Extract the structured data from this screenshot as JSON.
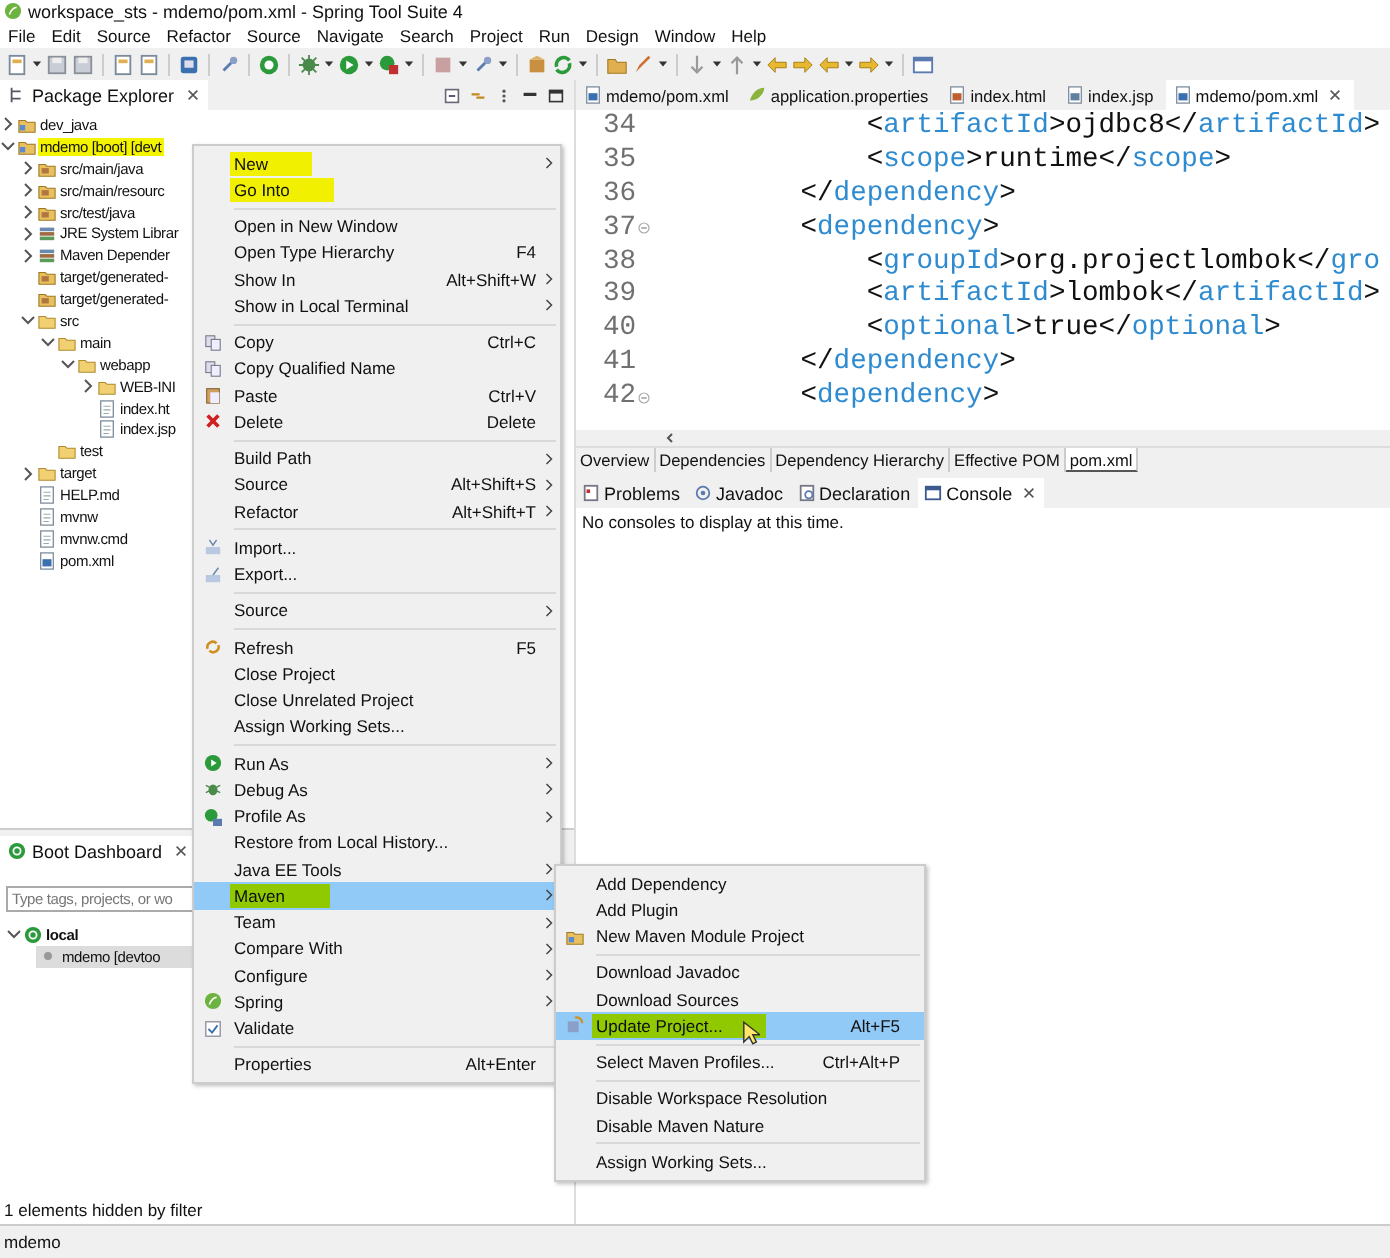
{
  "window": {
    "title": "workspace_sts - mdemo/pom.xml - Spring Tool Suite 4"
  },
  "menu_bar": [
    "File",
    "Edit",
    "Source",
    "Refactor",
    "Source",
    "Navigate",
    "Search",
    "Project",
    "Run",
    "Design",
    "Window",
    "Help"
  ],
  "package_explorer": {
    "title": "Package Explorer",
    "tree": [
      {
        "label": "dev_java",
        "kind": "project",
        "expanded": false,
        "marked": false
      },
      {
        "label": "mdemo [boot] [devt",
        "kind": "project",
        "expanded": true,
        "marked": true,
        "children": [
          {
            "label": "src/main/java",
            "kind": "source-folder",
            "expanded": false,
            "marked": false
          },
          {
            "label": "src/main/resourc",
            "kind": "source-folder",
            "expanded": false,
            "marked": false
          },
          {
            "label": "src/test/java",
            "kind": "source-folder",
            "expanded": false,
            "marked": false
          },
          {
            "label": "JRE System Librar",
            "kind": "library",
            "expanded": false,
            "marked": false
          },
          {
            "label": "Maven Depender",
            "kind": "library",
            "expanded": false,
            "marked": false
          },
          {
            "label": "target/generated-",
            "kind": "source-folder",
            "marked": false
          },
          {
            "label": "target/generated-",
            "kind": "source-folder",
            "marked": false
          },
          {
            "label": "src",
            "kind": "folder",
            "expanded": true,
            "marked": false,
            "children": [
              {
                "label": "main",
                "kind": "folder",
                "expanded": true,
                "marked": false,
                "children": [
                  {
                    "label": "webapp",
                    "kind": "folder",
                    "expanded": true,
                    "marked": false,
                    "children": [
                      {
                        "label": "WEB-INI",
                        "kind": "folder",
                        "expanded": false,
                        "marked": false
                      },
                      {
                        "label": "index.ht",
                        "kind": "file",
                        "marked": false
                      },
                      {
                        "label": "index.jsp",
                        "kind": "file",
                        "marked": false
                      }
                    ]
                  }
                ]
              },
              {
                "label": "test",
                "kind": "folder",
                "marked": false
              }
            ]
          },
          {
            "label": "target",
            "kind": "folder",
            "expanded": false,
            "marked": false
          },
          {
            "label": "HELP.md",
            "kind": "file",
            "marked": false
          },
          {
            "label": "mvnw",
            "kind": "file",
            "marked": false
          },
          {
            "label": "mvnw.cmd",
            "kind": "file",
            "marked": false
          },
          {
            "label": "pom.xml",
            "kind": "xml",
            "marked": false
          }
        ]
      }
    ]
  },
  "boot_dashboard": {
    "title": "Boot Dashboard",
    "search": {
      "placeholder": "Type tags, projects, or wo"
    },
    "tree": [
      {
        "label": "local",
        "expanded": true,
        "selected": false,
        "children": [
          {
            "label": "mdemo [devtoo",
            "selected": true
          }
        ]
      }
    ],
    "footer": "1 elements hidden by filter"
  },
  "editor": {
    "tabs": [
      {
        "label": "mdemo/pom.xml",
        "kind": "xml",
        "selected": false
      },
      {
        "label": "application.properties",
        "kind": "properties",
        "selected": false
      },
      {
        "label": "index.html",
        "kind": "html",
        "selected": false
      },
      {
        "label": "index.jsp",
        "kind": "jsp",
        "selected": false
      },
      {
        "label": "mdemo/pom.xml",
        "kind": "xml",
        "selected": true
      }
    ],
    "lines": [
      {
        "number": "34",
        "fold": false,
        "tokens": [
          {
            "kind": "plain",
            "text": "            <"
          },
          {
            "kind": "tag",
            "text": "artifactId"
          },
          {
            "kind": "plain",
            "text": ">ojdbc8</"
          },
          {
            "kind": "tag",
            "text": "artifactId"
          },
          {
            "kind": "plain",
            "text": ">"
          }
        ]
      },
      {
        "number": "35",
        "fold": false,
        "tokens": [
          {
            "kind": "plain",
            "text": "            <"
          },
          {
            "kind": "tag",
            "text": "scope"
          },
          {
            "kind": "plain",
            "text": ">runtime</"
          },
          {
            "kind": "tag",
            "text": "scope"
          },
          {
            "kind": "plain",
            "text": ">"
          }
        ]
      },
      {
        "number": "36",
        "fold": false,
        "tokens": [
          {
            "kind": "plain",
            "text": "        </"
          },
          {
            "kind": "tag",
            "text": "dependency"
          },
          {
            "kind": "plain",
            "text": ">"
          }
        ]
      },
      {
        "number": "37",
        "fold": true,
        "tokens": [
          {
            "kind": "plain",
            "text": "        <"
          },
          {
            "kind": "tag",
            "text": "dependency"
          },
          {
            "kind": "plain",
            "text": ">"
          }
        ]
      },
      {
        "number": "38",
        "fold": false,
        "tokens": [
          {
            "kind": "plain",
            "text": "            <"
          },
          {
            "kind": "tag",
            "text": "groupId"
          },
          {
            "kind": "plain",
            "text": ">org.projectlombok</"
          },
          {
            "kind": "tag",
            "text": "gro"
          }
        ]
      },
      {
        "number": "39",
        "fold": false,
        "tokens": [
          {
            "kind": "plain",
            "text": "            <"
          },
          {
            "kind": "tag",
            "text": "artifactId"
          },
          {
            "kind": "plain",
            "text": ">lombok</"
          },
          {
            "kind": "tag",
            "text": "artifactId"
          },
          {
            "kind": "plain",
            "text": ">"
          }
        ]
      },
      {
        "number": "40",
        "fold": false,
        "tokens": [
          {
            "kind": "plain",
            "text": "            <"
          },
          {
            "kind": "tag",
            "text": "optional"
          },
          {
            "kind": "plain",
            "text": ">true</"
          },
          {
            "kind": "tag",
            "text": "optional"
          },
          {
            "kind": "plain",
            "text": ">"
          }
        ]
      },
      {
        "number": "41",
        "fold": false,
        "tokens": [
          {
            "kind": "plain",
            "text": "        </"
          },
          {
            "kind": "tag",
            "text": "dependency"
          },
          {
            "kind": "plain",
            "text": ">"
          }
        ]
      },
      {
        "number": "42",
        "fold": true,
        "tokens": [
          {
            "kind": "plain",
            "text": "        <"
          },
          {
            "kind": "tag",
            "text": "dependency"
          },
          {
            "kind": "plain",
            "text": ">"
          }
        ]
      }
    ],
    "form_tabs": [
      {
        "label": "Overview",
        "selected": false
      },
      {
        "label": "Dependencies",
        "selected": false
      },
      {
        "label": "Dependency Hierarchy",
        "selected": false
      },
      {
        "label": "Effective POM",
        "selected": false
      },
      {
        "label": "pom.xml",
        "selected": true
      }
    ]
  },
  "console": {
    "tabs": [
      {
        "label": "Problems",
        "selected": false
      },
      {
        "label": "Javadoc",
        "selected": false
      },
      {
        "label": "Declaration",
        "selected": false
      },
      {
        "label": "Console",
        "selected": true
      }
    ],
    "message": "No consoles to display at this time."
  },
  "context_menu": {
    "groups": [
      [
        {
          "label": "New",
          "submenu": true,
          "selected": false,
          "marked": true
        },
        {
          "label": "Go Into",
          "submenu": false,
          "selected": false,
          "marked": true
        }
      ],
      [
        {
          "label": "Open in New Window",
          "submenu": false,
          "selected": false,
          "marked": false
        },
        {
          "label": "Open Type Hierarchy",
          "shortcut": "F4",
          "submenu": false,
          "selected": false,
          "marked": false
        },
        {
          "label": "Show In",
          "shortcut": "Alt+Shift+W",
          "submenu": true,
          "selected": false,
          "marked": false
        },
        {
          "label": "Show in Local Terminal",
          "submenu": true,
          "selected": false,
          "marked": false
        }
      ],
      [
        {
          "label": "Copy",
          "shortcut": "Ctrl+C",
          "submenu": false,
          "selected": false,
          "marked": false
        },
        {
          "label": "Copy Qualified Name",
          "submenu": false,
          "selected": false,
          "marked": false
        },
        {
          "label": "Paste",
          "shortcut": "Ctrl+V",
          "submenu": false,
          "selected": false,
          "marked": false
        },
        {
          "label": "Delete",
          "shortcut": "Delete",
          "submenu": false,
          "selected": false,
          "marked": false
        }
      ],
      [
        {
          "label": "Build Path",
          "submenu": true,
          "selected": false,
          "marked": false
        },
        {
          "label": "Source",
          "shortcut": "Alt+Shift+S",
          "submenu": true,
          "selected": false,
          "marked": false
        },
        {
          "label": "Refactor",
          "shortcut": "Alt+Shift+T",
          "submenu": true,
          "selected": false,
          "marked": false
        }
      ],
      [
        {
          "label": "Import...",
          "submenu": false,
          "selected": false,
          "marked": false
        },
        {
          "label": "Export...",
          "submenu": false,
          "selected": false,
          "marked": false
        }
      ],
      [
        {
          "label": "Source",
          "submenu": true,
          "selected": false,
          "marked": false
        }
      ],
      [
        {
          "label": "Refresh",
          "shortcut": "F5",
          "submenu": false,
          "selected": false,
          "marked": false
        },
        {
          "label": "Close Project",
          "submenu": false,
          "selected": false,
          "marked": false
        },
        {
          "label": "Close Unrelated Project",
          "submenu": false,
          "selected": false,
          "marked": false
        },
        {
          "label": "Assign Working Sets...",
          "submenu": false,
          "selected": false,
          "marked": false
        }
      ],
      [
        {
          "label": "Run As",
          "submenu": true,
          "selected": false,
          "marked": false
        },
        {
          "label": "Debug As",
          "submenu": true,
          "selected": false,
          "marked": false
        },
        {
          "label": "Profile As",
          "submenu": true,
          "selected": false,
          "marked": false
        },
        {
          "label": "Restore from Local History...",
          "submenu": false,
          "selected": false,
          "marked": false
        },
        {
          "label": "Java EE Tools",
          "submenu": true,
          "selected": false,
          "marked": false
        },
        {
          "label": "Maven",
          "submenu": true,
          "selected": true,
          "marked": true
        },
        {
          "label": "Team",
          "submenu": true,
          "selected": false,
          "marked": false
        },
        {
          "label": "Compare With",
          "submenu": true,
          "selected": false,
          "marked": false
        },
        {
          "label": "Configure",
          "submenu": true,
          "selected": false,
          "marked": false
        },
        {
          "label": "Spring",
          "submenu": true,
          "selected": false,
          "marked": false
        },
        {
          "label": "Validate",
          "submenu": false,
          "selected": false,
          "marked": false
        }
      ],
      [
        {
          "label": "Properties",
          "shortcut": "Alt+Enter",
          "submenu": false,
          "selected": false,
          "marked": false
        }
      ]
    ]
  },
  "maven_submenu": {
    "groups": [
      [
        {
          "label": "Add Dependency",
          "submenu": false,
          "selected": false,
          "marked": false
        },
        {
          "label": "Add Plugin",
          "submenu": false,
          "selected": false,
          "marked": false
        },
        {
          "label": "New Maven Module Project",
          "submenu": false,
          "selected": false,
          "marked": false
        }
      ],
      [
        {
          "label": "Download Javadoc",
          "submenu": false,
          "selected": false,
          "marked": false
        },
        {
          "label": "Download Sources",
          "submenu": false,
          "selected": false,
          "marked": false
        },
        {
          "label": "Update Project...",
          "shortcut": "Alt+F5",
          "submenu": false,
          "selected": true,
          "marked": true
        }
      ],
      [
        {
          "label": "Select Maven Profiles...",
          "shortcut": "Ctrl+Alt+P",
          "submenu": false,
          "selected": false,
          "marked": false
        }
      ],
      [
        {
          "label": "Disable Workspace Resolution",
          "submenu": false,
          "selected": false,
          "marked": false
        },
        {
          "label": "Disable Maven Nature",
          "submenu": false,
          "selected": false,
          "marked": false
        }
      ],
      [
        {
          "label": "Assign Working Sets...",
          "submenu": false,
          "selected": false,
          "marked": false
        }
      ]
    ]
  },
  "status_bar": "mdemo"
}
